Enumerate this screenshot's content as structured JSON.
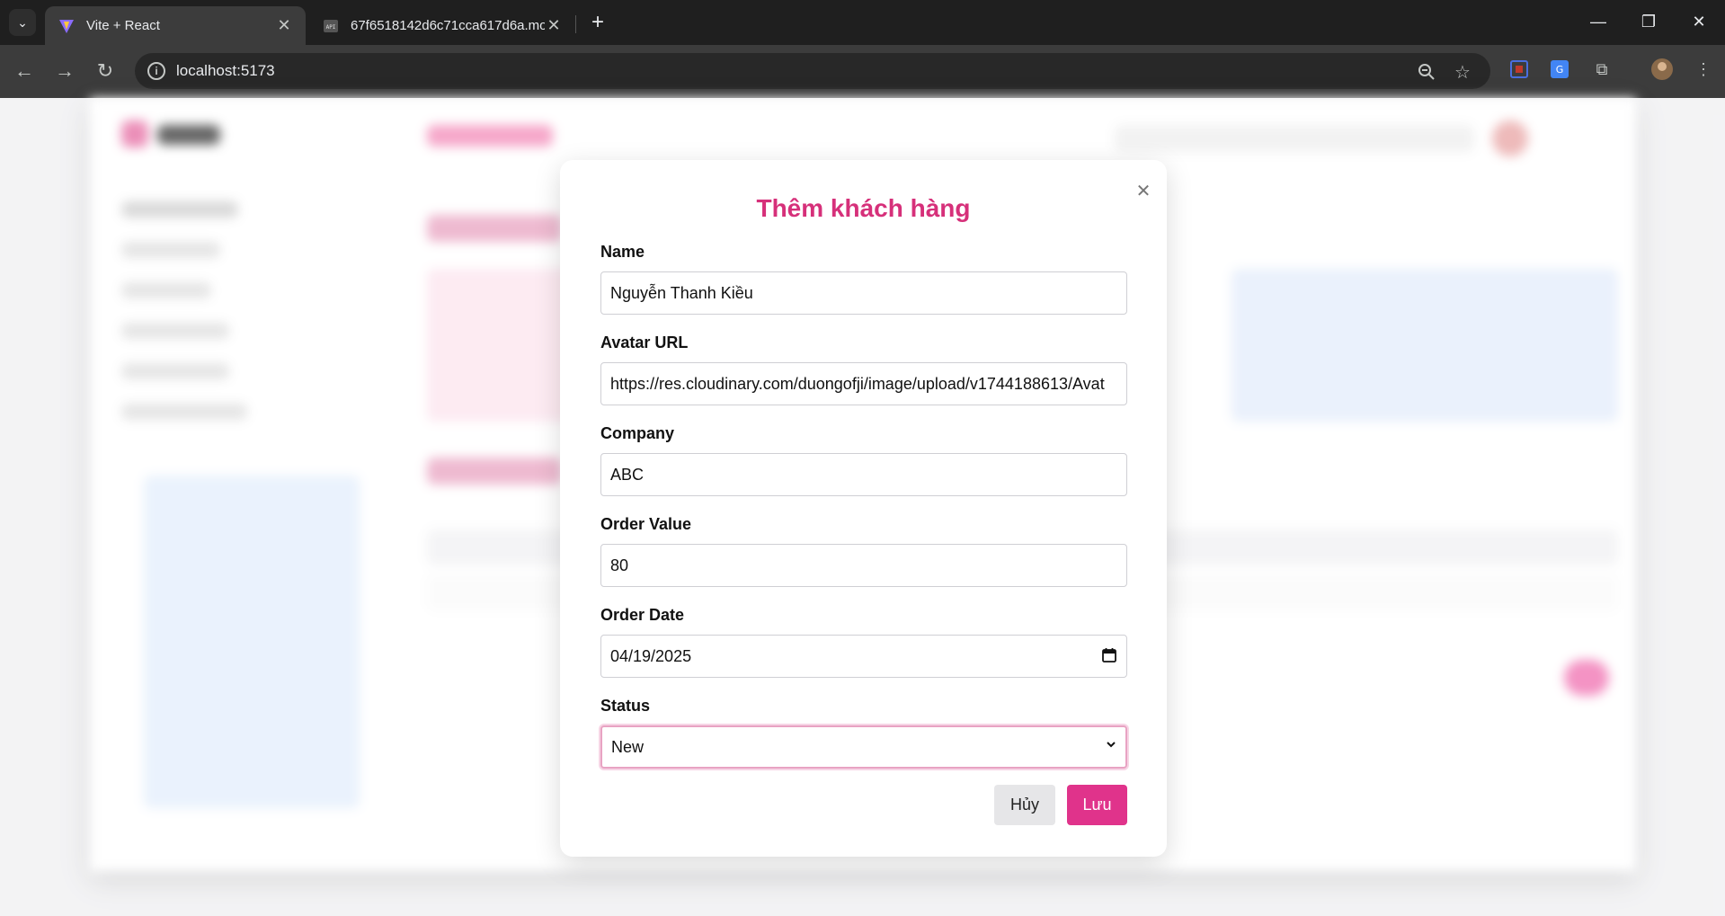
{
  "browser": {
    "tabs": [
      {
        "title": "Vite + React",
        "active": true
      },
      {
        "title": "67f6518142d6c71cca617d6a.mo",
        "active": false
      }
    ],
    "address": "localhost:5173"
  },
  "modal": {
    "title": "Thêm khách hàng",
    "fields": {
      "name": {
        "label": "Name",
        "value": "Nguyễn Thanh Kiều"
      },
      "avatar": {
        "label": "Avatar URL",
        "value": "https://res.cloudinary.com/duongofji/image/upload/v1744188613/Avat"
      },
      "company": {
        "label": "Company",
        "value": "ABC"
      },
      "order_value": {
        "label": "Order Value",
        "value": "80"
      },
      "order_date": {
        "label": "Order Date",
        "value": "04/19/2025"
      },
      "status": {
        "label": "Status",
        "value": "New"
      }
    },
    "cancel_label": "Hủy",
    "save_label": "Lưu"
  },
  "colors": {
    "accent": "#e0338b",
    "title": "#d6307a"
  }
}
